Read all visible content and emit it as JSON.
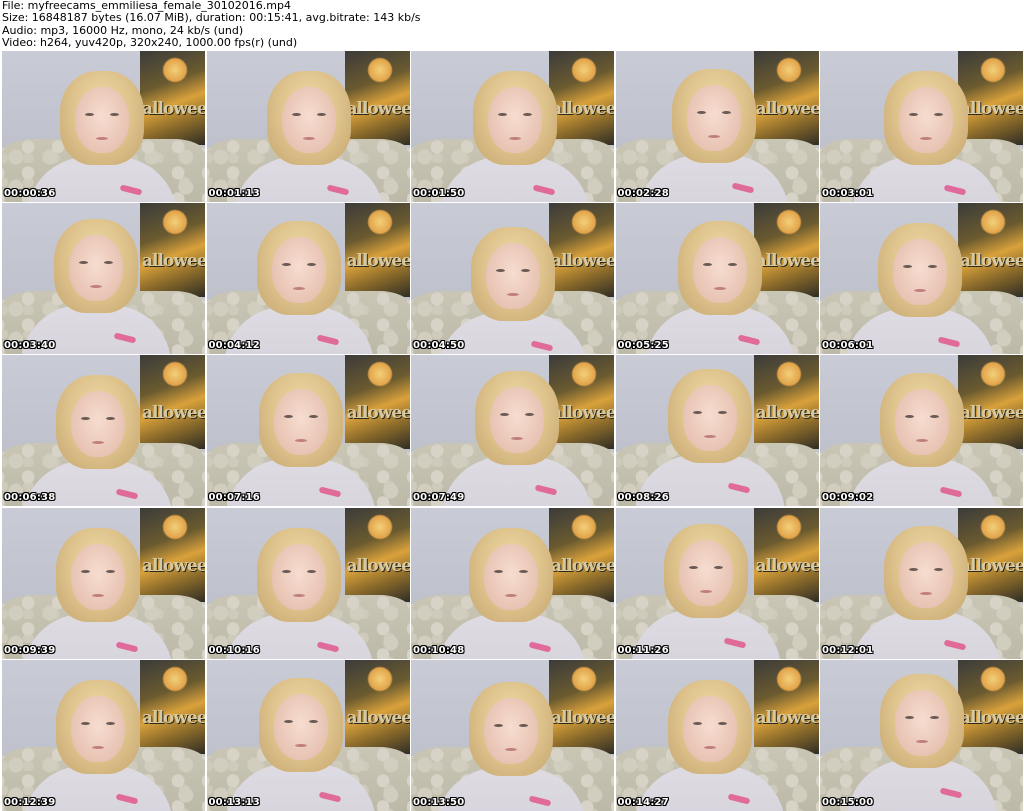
{
  "header": {
    "file": "File: myfreecams_emmiliesa_female_30102016.mp4",
    "size": "Size: 16848187 bytes (16.07 MiB), duration: 00:15:41, avg.bitrate: 143 kb/s",
    "audio": "Audio: mp3, 16000 Hz, mono, 24 kb/s (und)",
    "video": "Video: h264, yuv420p, 320x240, 1000.00 fps(r) (und)"
  },
  "poster_text": "allowee",
  "thumbnails": [
    {
      "timestamp": "00:00:36"
    },
    {
      "timestamp": "00:01:13"
    },
    {
      "timestamp": "00:01:50"
    },
    {
      "timestamp": "00:02:28"
    },
    {
      "timestamp": "00:03:01"
    },
    {
      "timestamp": "00:03:40"
    },
    {
      "timestamp": "00:04:12"
    },
    {
      "timestamp": "00:04:50"
    },
    {
      "timestamp": "00:05:25"
    },
    {
      "timestamp": "00:06:01"
    },
    {
      "timestamp": "00:06:38"
    },
    {
      "timestamp": "00:07:16"
    },
    {
      "timestamp": "00:07:49"
    },
    {
      "timestamp": "00:08:26"
    },
    {
      "timestamp": "00:09:02"
    },
    {
      "timestamp": "00:09:39"
    },
    {
      "timestamp": "00:10:16"
    },
    {
      "timestamp": "00:10:48"
    },
    {
      "timestamp": "00:11:26"
    },
    {
      "timestamp": "00:12:01"
    },
    {
      "timestamp": "00:12:39"
    },
    {
      "timestamp": "00:13:13"
    },
    {
      "timestamp": "00:13:50"
    },
    {
      "timestamp": "00:14:27"
    },
    {
      "timestamp": "00:15:00"
    }
  ]
}
